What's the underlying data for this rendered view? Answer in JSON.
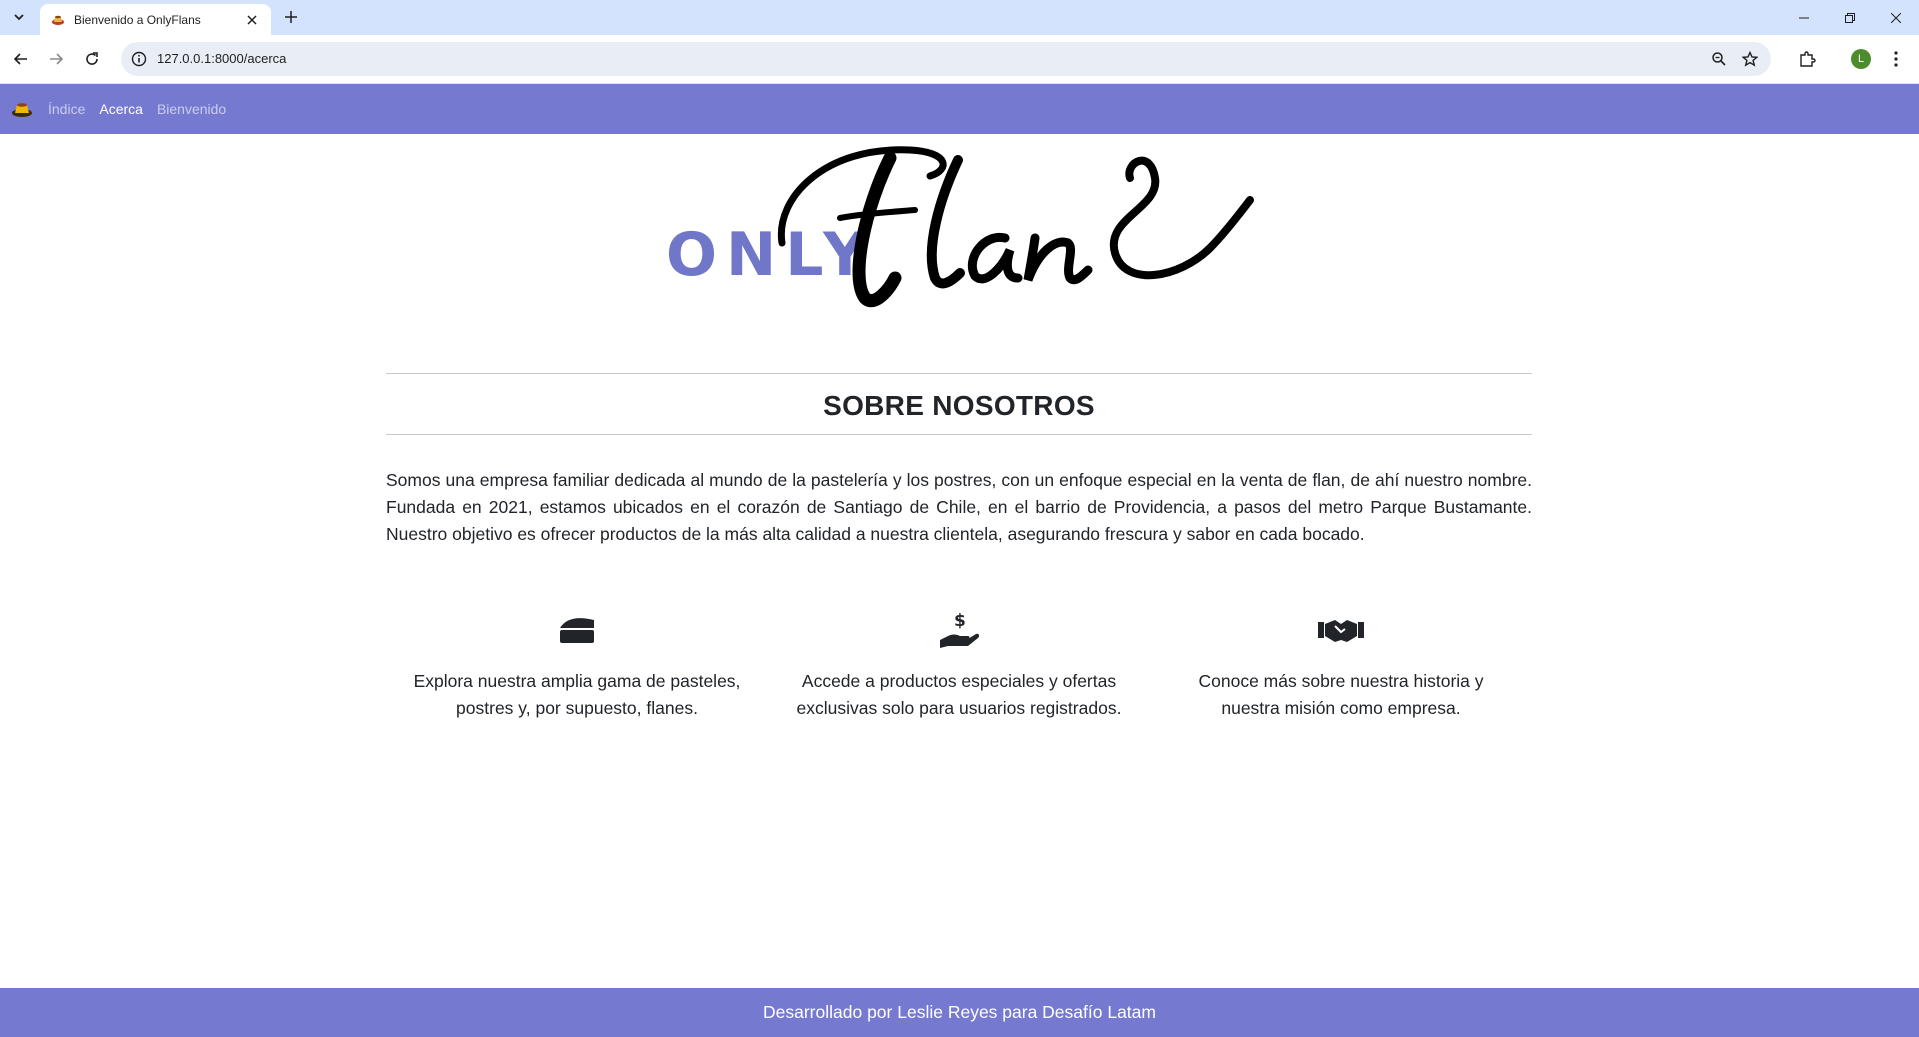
{
  "browser": {
    "tab_title": "Bienvenido a OnlyFlans",
    "url": "127.0.0.1:8000/acerca",
    "profile_initial": "L"
  },
  "nav": {
    "links": [
      {
        "label": "Índice",
        "active": false
      },
      {
        "label": "Acerca",
        "active": true
      },
      {
        "label": "Bienvenido",
        "active": false
      }
    ]
  },
  "logo": {
    "only": "ONLY",
    "flans": "Flans"
  },
  "about": {
    "title": "SOBRE NOSOTROS",
    "intro": "Somos una empresa familiar dedicada al mundo de la pastelería y los postres, con un enfoque especial en la venta de flan, de ahí nuestro nombre. Fundada en 2021, estamos ubicados en el corazón de Santiago de Chile, en el barrio de Providencia, a pasos del metro Parque Bustamante. Nuestro objetivo es ofrecer productos de la más alta calidad a nuestra clientela, asegurando frescura y sabor en cada bocado."
  },
  "features": [
    {
      "icon": "cake-slice-icon",
      "text": "Explora nuestra amplia gama de pasteles, postres y, por supuesto, flanes."
    },
    {
      "icon": "hand-holding-dollar-icon",
      "text": "Accede a productos especiales y ofertas exclusivas solo para usuarios registrados."
    },
    {
      "icon": "handshake-icon",
      "text": "Conoce más sobre nuestra historia y nuestra misión como empresa."
    }
  ],
  "footer": {
    "text": "Desarrollado por Leslie Reyes para Desafío Latam"
  },
  "colors": {
    "accent": "#7579d0",
    "logo_only": "#7076c8",
    "text": "#212529"
  }
}
